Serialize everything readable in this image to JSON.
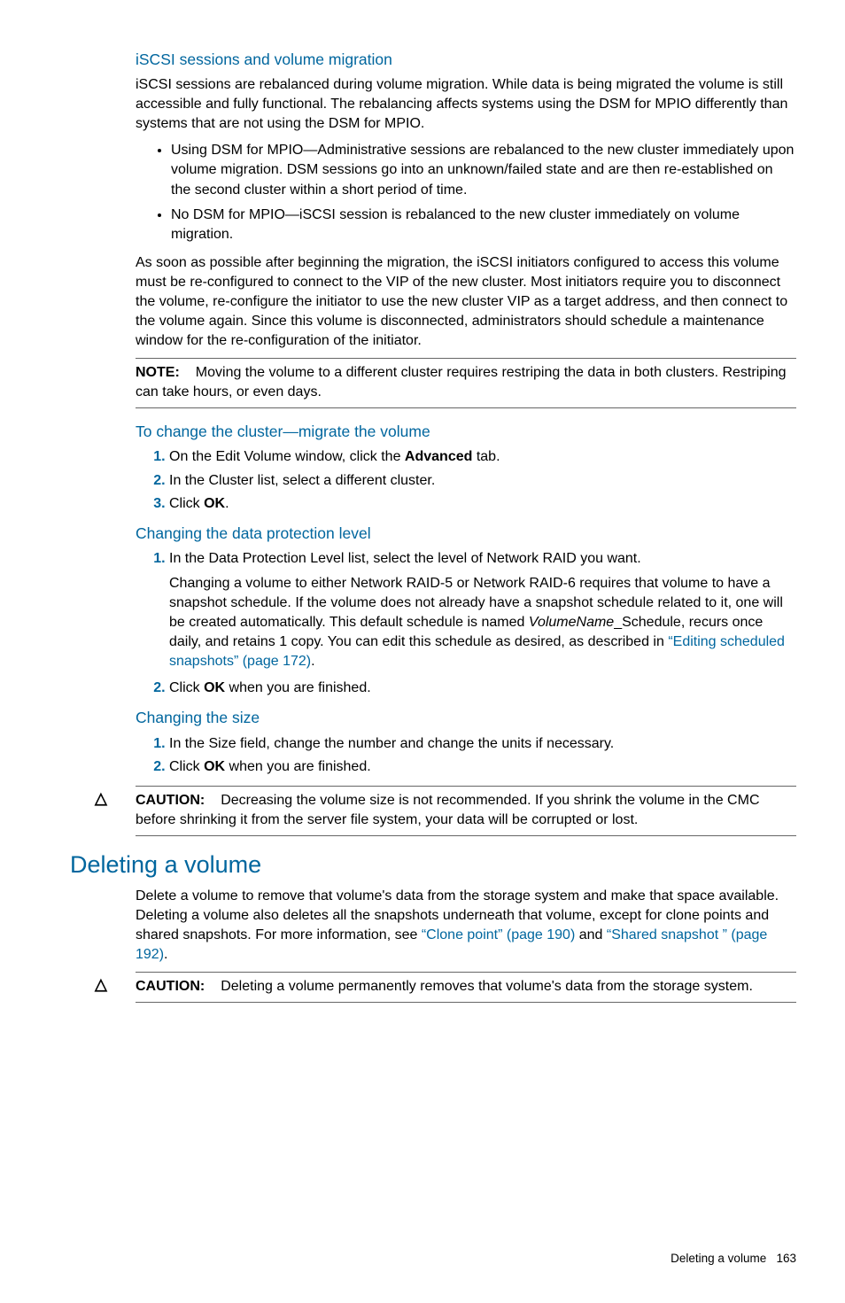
{
  "section1": {
    "heading": "iSCSI sessions and volume migration",
    "p1": "iSCSI sessions are rebalanced during volume migration. While data is being migrated the volume is still accessible and fully functional. The rebalancing affects systems using the DSM for MPIO differently than systems that are not using the DSM for MPIO.",
    "bullet1": "Using DSM for MPIO—Administrative sessions are rebalanced to the new cluster immediately upon volume migration. DSM sessions go into an unknown/failed state and are then re-established on the second cluster within a short period of time.",
    "bullet2": "No DSM for MPIO—iSCSI session is rebalanced to the new cluster immediately on volume migration.",
    "p2": "As soon as possible after beginning the migration, the iSCSI initiators configured to access this volume must be re-configured to connect to the VIP of the new cluster. Most initiators require you to disconnect the volume, re-configure the initiator to use the new cluster VIP as a target address, and then connect to the volume again. Since this volume is disconnected, administrators should schedule a maintenance window for the re-configuration of the initiator.",
    "note_label": "NOTE:",
    "note_text": "Moving the volume to a different cluster requires restriping the data in both clusters. Restriping can take hours, or even days."
  },
  "section2": {
    "heading": "To change the cluster—migrate the volume",
    "step1a": "On the Edit Volume window, click the ",
    "step1b": "Advanced",
    "step1c": " tab.",
    "step2": "In the Cluster list, select a different cluster.",
    "step3a": "Click ",
    "step3b": "OK",
    "step3c": "."
  },
  "section3": {
    "heading": "Changing the data protection level",
    "step1": "In the Data Protection Level list, select the level of Network RAID you want.",
    "step1_body_a": "Changing a volume to either Network RAID-5 or Network RAID-6 requires that volume to have a snapshot schedule. If the volume does not already have a snapshot schedule related to it, one will be created automatically. This default schedule is named ",
    "step1_body_i": "VolumeName",
    "step1_body_b": "_Schedule, recurs once daily, and retains 1 copy. You can edit this schedule as desired, as described in ",
    "step1_link": "“Editing scheduled snapshots” (page 172)",
    "step1_body_c": ".",
    "step2a": "Click ",
    "step2b": "OK",
    "step2c": " when you are finished."
  },
  "section4": {
    "heading": "Changing the size",
    "step1": "In the Size field, change the number and change the units if necessary.",
    "step2a": "Click ",
    "step2b": "OK",
    "step2c": " when you are finished.",
    "caution_label": "CAUTION:",
    "caution_text": "Decreasing the volume size is not recommended. If you shrink the volume in the CMC before shrinking it from the server file system, your data will be corrupted or lost."
  },
  "section5": {
    "heading": "Deleting a volume",
    "p1a": "Delete a volume to remove that volume's data from the storage system and make that space available. Deleting a volume also deletes all the snapshots underneath that volume, except for clone points and shared snapshots. For more information, see ",
    "link1": "“Clone point” (page 190)",
    "p1b": " and ",
    "link2": "“Shared snapshot ” (page 192)",
    "p1c": ".",
    "caution_label": "CAUTION:",
    "caution_text": "Deleting a volume permanently removes that volume's data from the storage system."
  },
  "footer": {
    "text": "Deleting a volume",
    "page": "163"
  },
  "glyph": {
    "caution": "△"
  }
}
